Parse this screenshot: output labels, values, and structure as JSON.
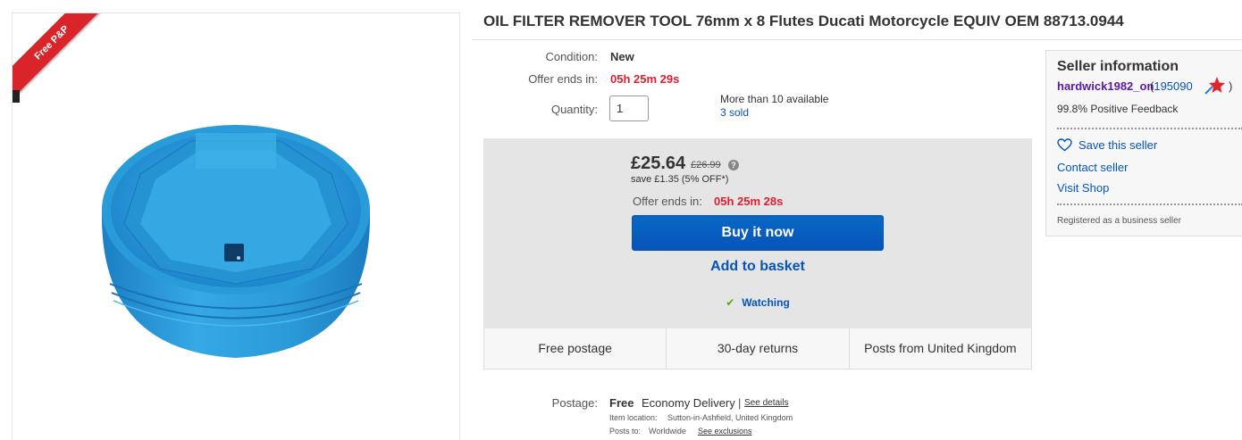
{
  "image_panel": {
    "ribbon_text": "Free P&P",
    "product_color": "#2596d6"
  },
  "title": "OIL FILTER REMOVER TOOL 76mm x 8 Flutes Ducati Motorcycle EQUIV OEM 88713.0944",
  "details": {
    "condition_label": "Condition:",
    "condition_value": "New",
    "offer_label": "Offer ends in:",
    "offer_value": "05h 25m 29s",
    "quantity_label": "Quantity:",
    "quantity_value": "1",
    "availability": "More than 10 available",
    "sold": "3 sold"
  },
  "buybox": {
    "price": "£25.64",
    "old_price": "£26.99",
    "info_icon": "?",
    "save_text": "save £1.35 (5% OFF*)",
    "offer_label": "Offer ends in:",
    "offer_value": "05h 25m 28s",
    "buy_now": "Buy it now",
    "add_basket": "Add to basket",
    "watching": "Watching",
    "check_icon": "✔"
  },
  "features": [
    "Free postage",
    "30-day returns",
    "Posts from United Kingdom"
  ],
  "postage": {
    "label": "Postage:",
    "free": "Free",
    "type": "Economy Delivery",
    "separator": "|",
    "see_details": "See details",
    "location_label": "Item location:",
    "location_value": "Sutton-in-Ashfield, United Kingdom",
    "posts_to_label": "Posts to:",
    "posts_to_value": "Worldwide",
    "see_exclusions": "See exclusions"
  },
  "seller": {
    "heading": "Seller information",
    "name": "hardwick1982_on",
    "open_paren": "(",
    "score": "195090",
    "close_paren": ")",
    "feedback": "99.8% Positive Feedback",
    "save_seller": "Save this seller",
    "contact": "Contact seller",
    "visit_shop": "Visit Shop",
    "registered": "Registered as a business seller"
  },
  "colors": {
    "link": "#0654ba",
    "timer": "#dd1e31",
    "buy_button": "#0654ba",
    "ribbon": "#d9252a",
    "seller_name": "#5a1aa8"
  }
}
